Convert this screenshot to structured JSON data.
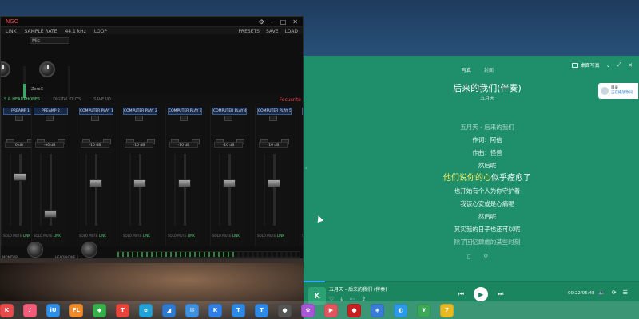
{
  "mixer": {
    "title_fragment": "NGO",
    "toolbar_left": [
      "LINK",
      "SAMPLE RATE",
      "44.1 kHz",
      "LOOP"
    ],
    "toolbar_right": [
      "PRESETS",
      "SAVE",
      "LOAD"
    ],
    "selector_value": "Mic",
    "top_label": "ZeroX",
    "tabs": [
      "S & HEADPHONES",
      "DIGITAL OUTS",
      "SAVE I/O"
    ],
    "brand": "Focusrite",
    "channels": [
      {
        "label": "PREAMP 1",
        "db": "0 dB",
        "fader_level": 0.72
      },
      {
        "label": "PREAMP 2",
        "db": "-90 dB",
        "fader_level": 0.18
      },
      {
        "label": "COMPUTER PLAY 1",
        "db": "-10 dB",
        "fader_level": 0.62
      },
      {
        "label": "COMPUTER PLAY 2",
        "db": "-10 dB",
        "fader_level": 0.62
      },
      {
        "label": "COMPUTER PLAY 3",
        "db": "-10 dB",
        "fader_level": 0.62
      },
      {
        "label": "COMPUTER PLAY 4",
        "db": "-10 dB",
        "fader_level": 0.62
      },
      {
        "label": "COMPUTER PLAY 5",
        "db": "-10 dB",
        "fader_level": 0.62
      },
      {
        "label": "COMPUTER PLAY 6",
        "db": "-10 dB",
        "fader_level": 0.62
      }
    ],
    "channel_foot": {
      "solo": "SOLO",
      "mute": "MUTE",
      "link": "LINK"
    },
    "bottom_labels": [
      "MONITOR",
      "HEADPHONE 1"
    ]
  },
  "player": {
    "tabs": [
      "写真",
      "封面"
    ],
    "desktop_lyrics": "桌面写真",
    "song_title": "后来的我们(伴奏)",
    "artist": "五月天",
    "lyrics": [
      {
        "text": "五月天 - 后来的我们",
        "style": "dim"
      },
      {
        "text": "作词：阿信",
        "style": "normal"
      },
      {
        "text": "作曲：怪兽",
        "style": "normal"
      },
      {
        "text": "然后呢",
        "style": "normal"
      },
      {
        "text_pre": "他们说你的心",
        "text_post": "似乎痊愈了",
        "style": "current"
      },
      {
        "text": "也开始有个人为你守护着",
        "style": "normal"
      },
      {
        "text": "我该心安或是心痛呢",
        "style": "normal"
      },
      {
        "text": "然后呢",
        "style": "normal"
      },
      {
        "text": "其实我的日子也还可以呢",
        "style": "normal"
      },
      {
        "text": "除了回忆肆虐的某些时刻",
        "style": "dim"
      }
    ],
    "user_card": {
      "name": "目录",
      "subtitle": "正在播放歌词"
    },
    "now_playing": "五月天 - 后来的我们 (伴奏)",
    "time": "00:22/05:48",
    "progress": 0.065,
    "colors": {
      "bg": "#1e8f6a",
      "bar": "#1b855f",
      "highlight": "#f2f06a",
      "progress": "#2fa7ff"
    }
  },
  "taskbar": {
    "apps": [
      {
        "name": "app-k-red",
        "letter": "K",
        "color": "#e94b4b"
      },
      {
        "name": "music",
        "letter": "♪",
        "color": "#f35d7a"
      },
      {
        "name": "app-iu",
        "letter": "iU",
        "color": "#2f8ee8"
      },
      {
        "name": "fl-studio",
        "letter": "FL",
        "color": "#f08b2b"
      },
      {
        "name": "app-green",
        "letter": "◆",
        "color": "#36b04a"
      },
      {
        "name": "app-shirt",
        "letter": "T",
        "color": "#e8453c"
      },
      {
        "name": "edge",
        "letter": "e",
        "color": "#22a3d8"
      },
      {
        "name": "app-blue",
        "letter": "◢",
        "color": "#2e7ad1"
      },
      {
        "name": "app-mail",
        "letter": "✉",
        "color": "#3d8fe0"
      },
      {
        "name": "app-k-blue",
        "letter": "K",
        "color": "#2f7fe6"
      },
      {
        "name": "app-t-1",
        "letter": "T",
        "color": "#2d88e6"
      },
      {
        "name": "app-t-2",
        "letter": "T",
        "color": "#2d88e6"
      },
      {
        "name": "app-chat",
        "letter": "●",
        "color": "#555"
      },
      {
        "name": "app-colorful",
        "letter": "✿",
        "color": "#a855d8"
      },
      {
        "name": "app-video",
        "letter": "▶",
        "color": "#e0565f"
      },
      {
        "name": "app-record",
        "letter": "●",
        "color": "#c82020"
      },
      {
        "name": "app-shield",
        "letter": "◈",
        "color": "#3a7bd5"
      },
      {
        "name": "app-penguin",
        "letter": "◐",
        "color": "#2b9ae8"
      },
      {
        "name": "app-leaf",
        "letter": "❦",
        "color": "#3aa856"
      },
      {
        "name": "app-7",
        "letter": "7",
        "color": "#e7b923"
      }
    ]
  }
}
